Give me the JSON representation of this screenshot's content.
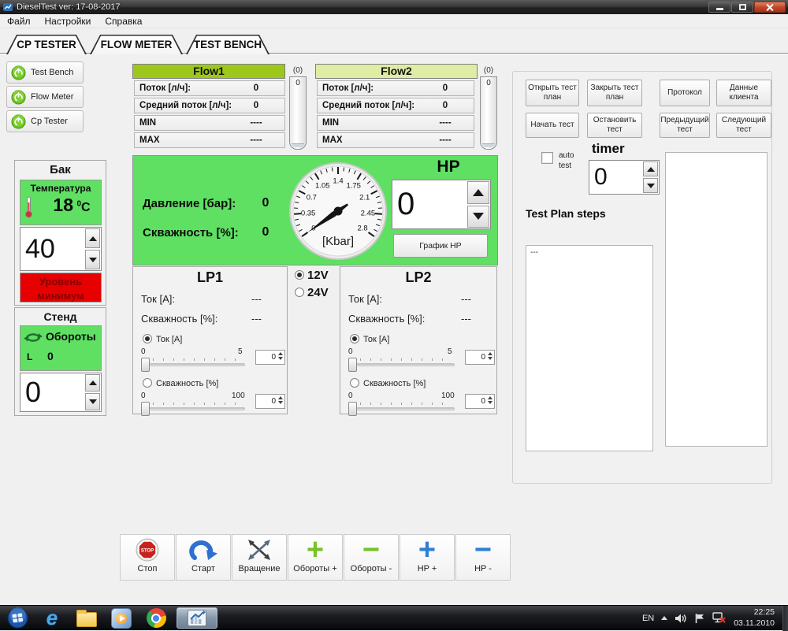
{
  "window": {
    "title": "DieselTest ver: 17-08-2017"
  },
  "menu": {
    "items": [
      "Файл",
      "Настройки",
      "Справка"
    ]
  },
  "tabs": {
    "items": [
      "CP TESTER",
      "FLOW METER",
      "TEST BENCH"
    ]
  },
  "sidebar": {
    "buttons": [
      "Test Bench",
      "Flow Meter",
      "Cp Tester"
    ]
  },
  "tank": {
    "title": "Бак",
    "temp_label": "Температура",
    "temp_value": "18",
    "temp_unit_sup": "0",
    "temp_unit": "C",
    "setpoint": "40",
    "alarm_line1": "Уровень",
    "alarm_line2": "минимум"
  },
  "stand": {
    "title": "Стенд",
    "rpm_label": "Обороты",
    "rpm_prefix": "L",
    "rpm_value": "0",
    "setpoint": "0"
  },
  "flow1": {
    "title": "Flow1",
    "rows": [
      {
        "label": "Поток [л/ч]:",
        "value": "0"
      },
      {
        "label": "Средний поток [л/ч]:",
        "value": "0"
      },
      {
        "label": "MIN",
        "value": "----"
      },
      {
        "label": "MAX",
        "value": "----"
      }
    ],
    "tube_label": "(0)",
    "tube_value": "0"
  },
  "flow2": {
    "title": "Flow2",
    "rows": [
      {
        "label": "Поток [л/ч]:",
        "value": "0"
      },
      {
        "label": "Средний поток [л/ч]:",
        "value": "0"
      },
      {
        "label": "MIN",
        "value": "----"
      },
      {
        "label": "MAX",
        "value": "----"
      }
    ],
    "tube_label": "(0)",
    "tube_value": "0"
  },
  "hp_panel": {
    "pressure_label": "Давление [бар]:",
    "pressure_value": "0",
    "duty_label": "Скважность [%]:",
    "duty_value": "0",
    "title": "HP",
    "setpoint": "0",
    "graph_button": "График HP",
    "gauge": {
      "unit": "[Kbar]",
      "labels": [
        "0",
        "0.35",
        "0.7",
        "1.05",
        "1.4",
        "1.75",
        "2.1",
        "2.45",
        "2.8"
      ],
      "min": 0,
      "max": 2.8,
      "value": 0
    }
  },
  "voltage": {
    "option1": "12V",
    "option2": "24V",
    "selected": "12V"
  },
  "lp1": {
    "title": "LP1",
    "current_label": "Ток [A]:",
    "current_value": "---",
    "duty_label": "Скважность [%]:",
    "duty_value": "---",
    "radio_current": "Ток [A]",
    "radio_duty": "Скважность [%]",
    "slider_current": {
      "min": "0",
      "max": "5",
      "value": "0"
    },
    "slider_duty": {
      "min": "0",
      "max": "100",
      "value": "0"
    }
  },
  "lp2": {
    "title": "LP2",
    "current_label": "Ток [A]:",
    "current_value": "---",
    "duty_label": "Скважность [%]:",
    "duty_value": "---",
    "radio_current": "Ток [A]",
    "radio_duty": "Скважность [%]",
    "slider_current": {
      "min": "0",
      "max": "5",
      "value": "0"
    },
    "slider_duty": {
      "min": "0",
      "max": "100",
      "value": "0"
    }
  },
  "test_panel": {
    "buttons": [
      "Открыть тест план",
      "Закрыть тест план",
      "Протокол",
      "Данные клиента",
      "Начать тест",
      "Остановить тест",
      "Предыдущий тест",
      "Следующий тест"
    ],
    "auto_test_label": "auto test",
    "timer_label": "timer",
    "timer_value": "0",
    "steps_title": "Test Plan steps",
    "steps": [
      "---"
    ]
  },
  "toolbar": {
    "stop_text": "STOP",
    "buttons": [
      {
        "label": "Стоп"
      },
      {
        "label": "Старт"
      },
      {
        "label": "Вращение"
      },
      {
        "label": "Обороты +",
        "glyph": "+"
      },
      {
        "label": "Обороты -",
        "glyph": "−"
      },
      {
        "label": "HP +",
        "glyph": "+"
      },
      {
        "label": "HP -",
        "glyph": "−"
      }
    ]
  },
  "taskbar": {
    "ie_glyph": "e",
    "lang": "EN",
    "time": "22:25",
    "date": "03.11.2010"
  },
  "colors": {
    "bright_green": "#5fe063",
    "flow1_header_green": "#9dc81b",
    "flow2_header_green": "#dfeca4",
    "alarm_red": "#e60000",
    "accent_blue": "#2e7fd6",
    "accent_green": "#76c327"
  }
}
